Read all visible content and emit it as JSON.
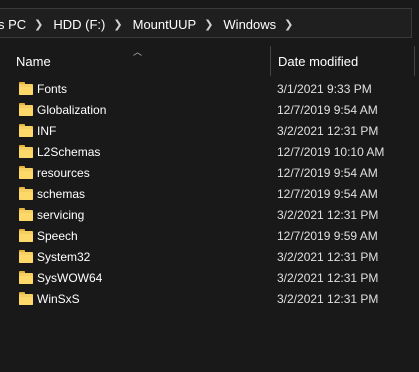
{
  "breadcrumb": [
    "s PC",
    "HDD (F:)",
    "MountUUP",
    "Windows"
  ],
  "columns": {
    "name": "Name",
    "date": "Date modified"
  },
  "icons": {
    "sort": "chevron-up-icon",
    "folder": "folder-icon",
    "separator": "chevron-right-icon"
  },
  "files": [
    {
      "name": "Fonts",
      "date": "3/1/2021 9:33 PM"
    },
    {
      "name": "Globalization",
      "date": "12/7/2019 9:54 AM"
    },
    {
      "name": "INF",
      "date": "3/2/2021 12:31 PM"
    },
    {
      "name": "L2Schemas",
      "date": "12/7/2019 10:10 AM"
    },
    {
      "name": "resources",
      "date": "12/7/2019 9:54 AM"
    },
    {
      "name": "schemas",
      "date": "12/7/2019 9:54 AM"
    },
    {
      "name": "servicing",
      "date": "3/2/2021 12:31 PM"
    },
    {
      "name": "Speech",
      "date": "12/7/2019 9:59 AM"
    },
    {
      "name": "System32",
      "date": "3/2/2021 12:31 PM"
    },
    {
      "name": "SysWOW64",
      "date": "3/2/2021 12:31 PM"
    },
    {
      "name": "WinSxS",
      "date": "3/2/2021 12:31 PM"
    }
  ]
}
